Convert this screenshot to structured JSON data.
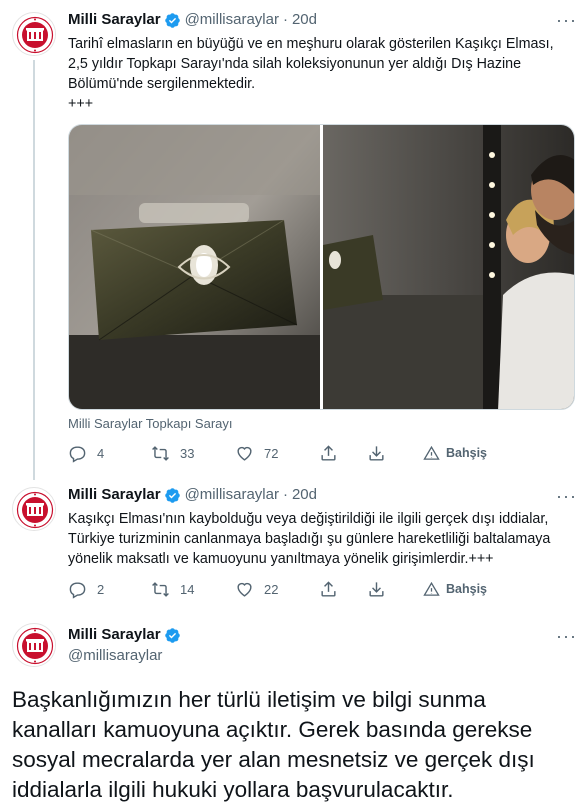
{
  "tweets": [
    {
      "name": "Milli Saraylar",
      "handle": "@millisaraylar",
      "dot": "·",
      "time": "20d",
      "more": "···",
      "text": "Tarihî elmasların en büyüğü ve en meşhuru olarak gösterilen Kaşıkçı Elması,\n2,5 yıldır Topkapı Sarayı'nda silah koleksiyonunun yer aldığı Dış Hazine\nBölümü'nde sergilenmektedir.\n+++",
      "media_caption": "Milli Saraylar Topkapı Sarayı",
      "replies": "4",
      "retweets": "33",
      "likes": "72",
      "tip_label": "Bahşiş"
    },
    {
      "name": "Milli Saraylar",
      "handle": "@millisaraylar",
      "dot": "·",
      "time": "20d",
      "more": "···",
      "text": "Kaşıkçı Elması'nın kaybolduğu veya değiştirildiği ile ilgili gerçek dışı iddialar,\nTürkiye turizminin canlanmaya başladığı şu günlere hareketliliği baltalamaya\nyönelik maksatlı ve kamuoyunu yanıltmaya yönelik girişimlerdir.+++",
      "replies": "2",
      "retweets": "14",
      "likes": "22",
      "tip_label": "Bahşiş"
    },
    {
      "name": "Milli Saraylar",
      "handle": "@millisaraylar",
      "more": "···",
      "text": "Başkanlığımızın her türlü iletişim ve bilgi sunma\nkanalları kamuoyuna açıktır. Gerek basında gerekse\nsosyal mecralarda yer alan mesnetsiz ve gerçek dışı\niddialarla ilgili hukuki yollara başvurulacaktır."
    }
  ],
  "colors": {
    "text_primary": "#0f1419",
    "text_secondary": "#536471",
    "verified_blue": "#1d9bf0",
    "logo_red": "#c8102e",
    "thread_line": "#cfd9de"
  },
  "icons": [
    "verified-badge-icon",
    "more-icon",
    "reply-icon",
    "retweet-icon",
    "like-icon",
    "share-icon",
    "download-icon",
    "tip-icon",
    "milli-saraylar-logo"
  ]
}
